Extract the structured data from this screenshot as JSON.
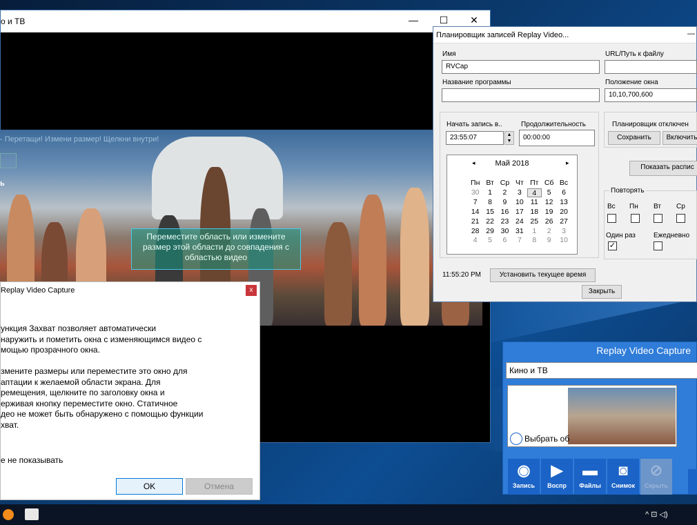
{
  "main_window": {
    "title": "о и ТВ",
    "minimize": "—",
    "maximize": "☐",
    "close": "✕",
    "video_hint": "- Перетащи! Измени размер! Щелкни внутри!",
    "video_side_label": "ь",
    "overlay_text": "Переместите область или измените размер этой области до совпадения с областью видео"
  },
  "scheduler": {
    "title": "Планировщик записей Replay Video...",
    "minimize": "—",
    "name_label": "Имя",
    "name_value": "RVCap",
    "url_label": "URL/Путь к файлу",
    "url_value": "",
    "program_label": "Название программы",
    "program_value": "",
    "window_pos_label": "Положение окна",
    "window_pos_value": "10,10,700,600",
    "start_label": "Начать запись в..",
    "start_value": "23:55:07",
    "duration_label": "Продолжительность",
    "duration_value": "00:00:00",
    "scheduler_status": "Планировщик отключен",
    "save_label": "Сохранить",
    "enable_label": "Включить",
    "show_schedule_label": "Показать распис",
    "repeat_label": "Повторять",
    "repeat_days": [
      "Вс",
      "Пн",
      "Вт",
      "Ср"
    ],
    "once_label": "Один раз",
    "daily_label": "Ежедневно",
    "current_time": "11:55:20 PM",
    "set_time_label": "Установить текущее время",
    "close_label": "Закрыть",
    "calendar": {
      "month": "Май 2018",
      "prev": "◂",
      "next": "▸",
      "weekdays": [
        "Пн",
        "Вт",
        "Ср",
        "Чт",
        "Пт",
        "Сб",
        "Вс"
      ],
      "weeks": [
        [
          "30",
          "1",
          "2",
          "3",
          "4",
          "5",
          "6"
        ],
        [
          "7",
          "8",
          "9",
          "10",
          "11",
          "12",
          "13"
        ],
        [
          "14",
          "15",
          "16",
          "17",
          "18",
          "19",
          "20"
        ],
        [
          "21",
          "22",
          "23",
          "24",
          "25",
          "26",
          "27"
        ],
        [
          "28",
          "29",
          "30",
          "31",
          "1",
          "2",
          "3"
        ],
        [
          "4",
          "5",
          "6",
          "7",
          "8",
          "9",
          "10"
        ]
      ],
      "selected": "4"
    }
  },
  "dialog": {
    "title": "Replay Video Capture",
    "close": "x",
    "p1": [
      "ункция Захват позволяет автоматически",
      "наружить и пометить окна с изменяющимся видео с",
      "мощью прозрачного окна."
    ],
    "p2": [
      "змените размеры или переместите это окно для",
      "аптации к желаемой области экрана. Для",
      "ремещения, щелкните по заголовку окна и",
      "ерживая кнопку переместите окно. Статичное",
      "део не может быть обнаружено с помощью функции",
      "хват."
    ],
    "dont_show": "е не показывать",
    "ok": "OK",
    "cancel": "Отмена"
  },
  "rvc_panel": {
    "title": "Replay Video Capture",
    "source": "Кино и ТВ",
    "select_label": "Выбрать об",
    "buttons": {
      "record": "Запись",
      "play": "Воспр",
      "files": "Файлы",
      "snapshot": "Снимок",
      "hide": "Скрыть"
    }
  },
  "taskbar": {
    "tray": "^ ⊡ ◁)"
  },
  "colors": {
    "accent": "#2f7cd9",
    "dialog_close": "#c8363a",
    "overlay": "#149682"
  }
}
